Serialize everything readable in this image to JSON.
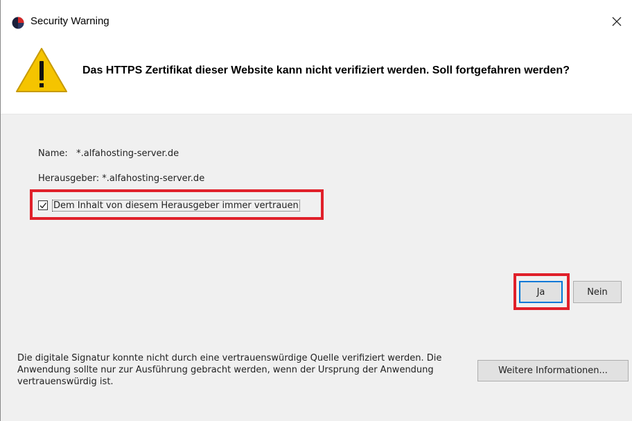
{
  "window": {
    "title": "Security Warning"
  },
  "header": {
    "message": "Das HTTPS Zertifikat dieser Website kann nicht verifiziert werden. Soll fortgefahren werden?"
  },
  "details": {
    "name_label": "Name:",
    "name_value": "*.alfahosting-server.de",
    "publisher_label": "Herausgeber:",
    "publisher_value": "*.alfahosting-server.de"
  },
  "trust_checkbox": {
    "label": "Dem Inhalt von diesem Herausgeber immer vertrauen",
    "checked": true
  },
  "buttons": {
    "yes": "Ja",
    "no": "Nein",
    "more_info": "Weitere Informationen..."
  },
  "footer": {
    "text": "Die digitale Signatur konnte nicht durch eine vertrauenswürdige Quelle verifiziert werden. Die Anwendung sollte nur zur Ausführung gebracht werden, wenn der Ursprung der Anwendung vertrauenswürdig ist."
  },
  "colors": {
    "highlight": "#e0202a",
    "warning_yellow": "#f5c400",
    "focus_blue": "#0078d7"
  },
  "icons": {
    "app": "java-security-icon",
    "warning": "warning-triangle-icon",
    "close": "close-icon",
    "check": "checkmark-icon"
  }
}
